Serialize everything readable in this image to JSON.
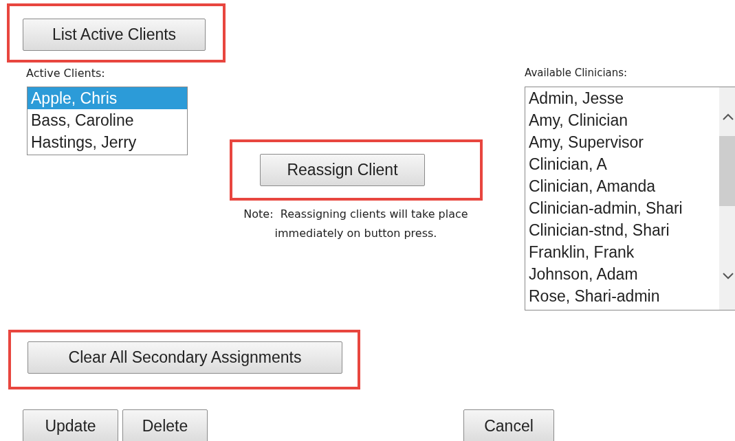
{
  "list_active_clients_button": {
    "label": "List Active Clients",
    "highlighted": true
  },
  "active_clients": {
    "label": "Active Clients:",
    "items": [
      {
        "name": "Apple, Chris",
        "selected": true
      },
      {
        "name": "Bass, Caroline",
        "selected": false
      },
      {
        "name": "Hastings, Jerry",
        "selected": false
      }
    ]
  },
  "reassign_button": {
    "label": "Reassign Client",
    "highlighted": true
  },
  "note": [
    "Note:  Reassigning clients will take place",
    "immediately on button press."
  ],
  "available_clinicians": {
    "label": "Available Clinicians:",
    "items": [
      {
        "name": "Admin, Jesse",
        "selected": false
      },
      {
        "name": "Amy, Clinician",
        "selected": false
      },
      {
        "name": "Amy, Supervisor",
        "selected": false
      },
      {
        "name": "Clinician, A",
        "selected": false
      },
      {
        "name": "Clinician, Amanda",
        "selected": false
      },
      {
        "name": "Clinician-admin, Shari",
        "selected": false
      },
      {
        "name": "Clinician-stnd, Shari",
        "selected": false
      },
      {
        "name": "Franklin, Frank",
        "selected": false
      },
      {
        "name": "Johnson, Adam",
        "selected": false
      },
      {
        "name": "Rose, Shari-admin",
        "selected": false
      }
    ]
  },
  "clear_button": {
    "label": "Clear All Secondary Assignments",
    "highlighted": true
  },
  "bottom_buttons": [
    {
      "label": "Update"
    },
    {
      "label": "Delete"
    },
    {
      "label": "Cancel"
    }
  ]
}
